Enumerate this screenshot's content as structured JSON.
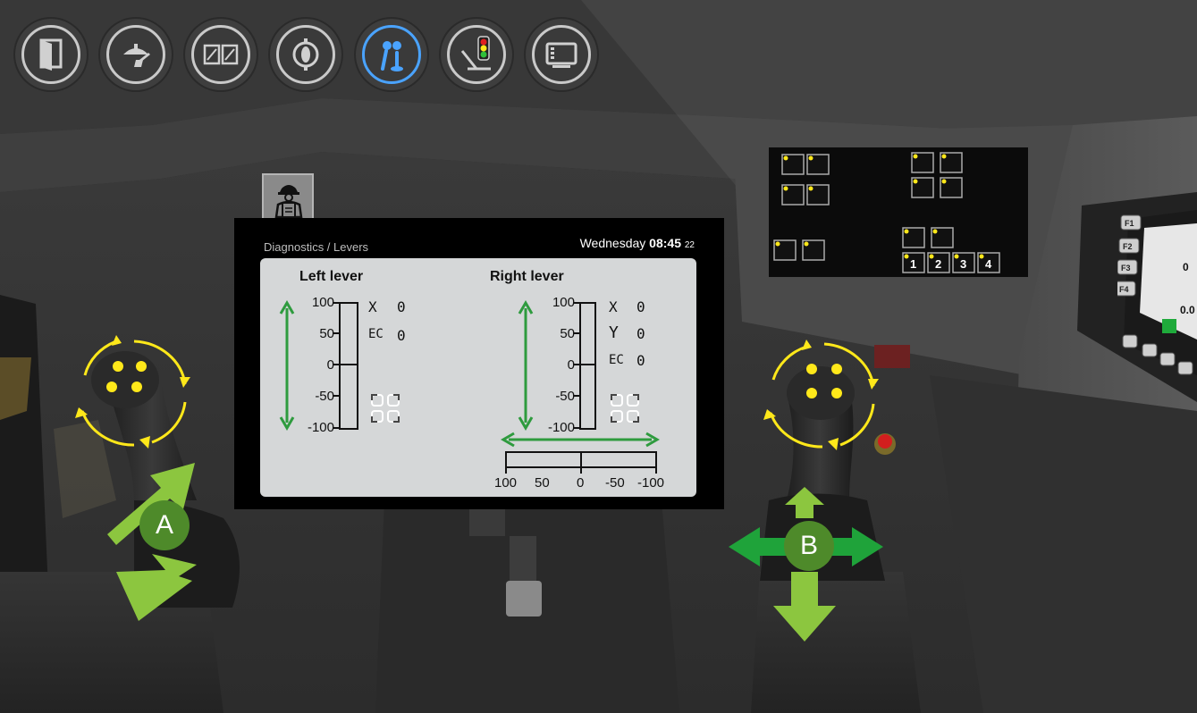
{
  "toolbar": {
    "buttons": [
      {
        "name": "door-panel-icon",
        "active": false
      },
      {
        "name": "cabin-cleaning-icon",
        "active": false
      },
      {
        "name": "windows-icon",
        "active": false
      },
      {
        "name": "hydraulics-icon",
        "active": false
      },
      {
        "name": "levers-icon",
        "active": true
      },
      {
        "name": "traffic-light-icon",
        "active": false
      },
      {
        "name": "display-icon",
        "active": false
      }
    ]
  },
  "diagnostics_button_icon": "operator-clipboard-icon",
  "screen": {
    "breadcrumb": "Diagnostics / Levers",
    "day": "Wednesday",
    "time": "08:45",
    "seconds": "22",
    "left_lever": {
      "title": "Left lever",
      "ticks": [
        "100",
        "50",
        "0",
        "-50",
        "-100"
      ],
      "readouts": [
        {
          "label": "X",
          "value": "0"
        },
        {
          "label": "EC",
          "value": "0"
        }
      ]
    },
    "right_lever": {
      "title": "Right lever",
      "ticks": [
        "100",
        "50",
        "0",
        "-50",
        "-100"
      ],
      "readouts": [
        {
          "label": "X",
          "value": "0"
        },
        {
          "label": "Y",
          "value": "0"
        },
        {
          "label": "EC",
          "value": "0"
        }
      ],
      "h_ticks": [
        "100",
        "50",
        "0",
        "-50",
        "-100"
      ]
    }
  },
  "markers": {
    "left": "A",
    "right": "B"
  },
  "right_panel": {
    "num_buttons": [
      "1",
      "2",
      "3",
      "4"
    ],
    "f_keys": [
      "F1",
      "F2",
      "F3",
      "F4"
    ],
    "readout_values": [
      "0",
      "0.0"
    ]
  },
  "colors": {
    "active_accent": "#4aa3ff",
    "arrow_green": "#8cc63f",
    "marker_green": "#4e8a2a",
    "rotation_yellow": "#ffe81a",
    "gauge_green": "#2e9b3e"
  }
}
